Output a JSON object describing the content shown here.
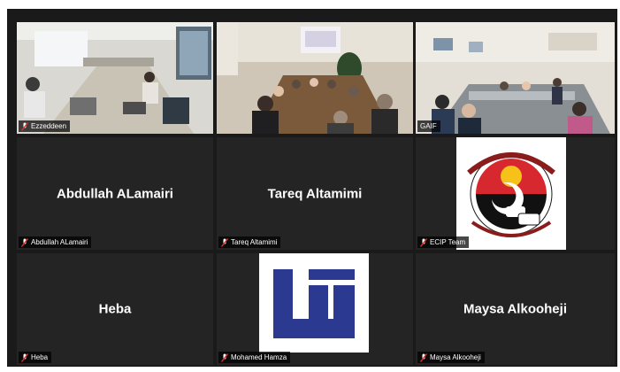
{
  "meeting": {
    "accent_color": "#b7d33c",
    "tile_color": "#242424",
    "participants": [
      {
        "display": "video",
        "label": "Ezzeddeen",
        "muted": true,
        "icon": "mic-muted-icon"
      },
      {
        "display": "video",
        "label": "",
        "muted": false
      },
      {
        "display": "video",
        "label": "GAIF",
        "muted": false,
        "active_speaker": true
      },
      {
        "display": "name",
        "name": "Abdullah ALamairi",
        "label": "Abdullah ALamairi",
        "muted": true,
        "icon": "mic-muted-icon"
      },
      {
        "display": "name",
        "name": "Tareq Altamimi",
        "label": "Tareq Altamimi",
        "muted": true,
        "icon": "mic-muted-icon"
      },
      {
        "display": "avatar-logo",
        "label": "ECIP Team",
        "muted": true,
        "icon": "mic-muted-icon",
        "logo_text_top": "المجمعة المصرية للتأمين الإجباري",
        "logo_text_bottom": "عن المسئولية المدنية الناشئة عن حوادث المركبات"
      },
      {
        "display": "name",
        "name": "Heba",
        "label": "Heba",
        "muted": true,
        "icon": "mic-muted-icon"
      },
      {
        "display": "avatar-logo",
        "label": "Mohamed Hamza",
        "muted": true,
        "icon": "mic-muted-icon",
        "logo_color": "#2b3991"
      },
      {
        "display": "name",
        "name": "Maysa Alkooheji",
        "label": "Maysa Alkooheji",
        "muted": true,
        "icon": "mic-muted-icon"
      }
    ]
  }
}
